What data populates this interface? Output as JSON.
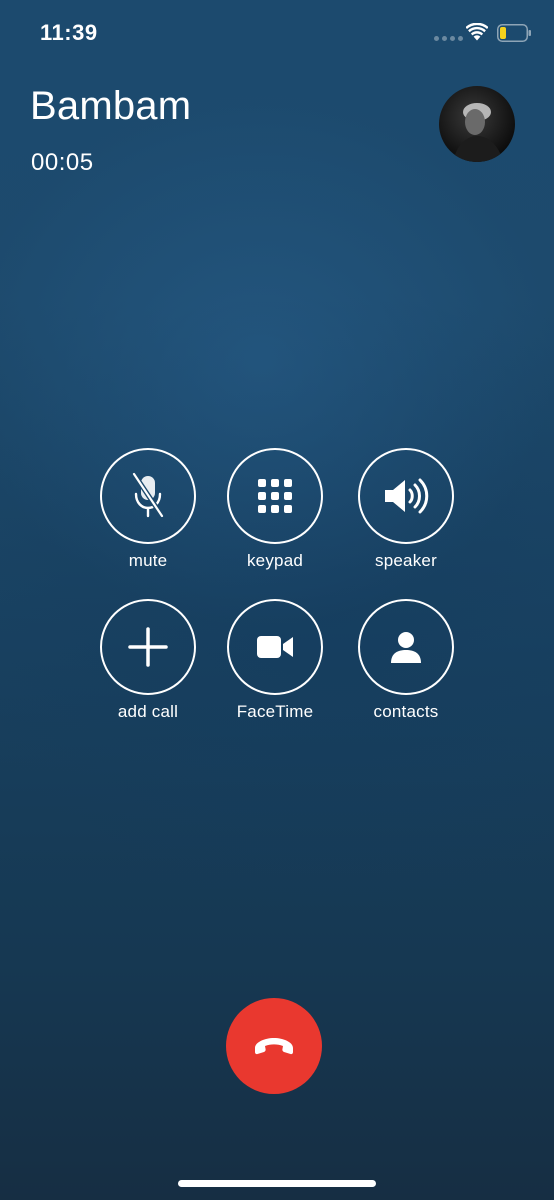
{
  "status_bar": {
    "time": "11:39",
    "battery_color": "#f5d21c"
  },
  "call": {
    "caller_name": "Bambam",
    "duration": "00:05"
  },
  "controls": {
    "mute": "mute",
    "keypad": "keypad",
    "speaker": "speaker",
    "add_call": "add call",
    "facetime": "FaceTime",
    "contacts": "contacts"
  },
  "icons": {
    "mute": "mic-slash-icon",
    "keypad": "keypad-grid-icon",
    "speaker": "speaker-wave-icon",
    "add_call": "plus-icon",
    "facetime": "video-camera-icon",
    "contacts": "person-icon",
    "end_call": "phone-down-icon"
  },
  "colors": {
    "end_call": "#e9382f",
    "background_top": "#1c4a6e",
    "background_bottom": "#162e43"
  }
}
